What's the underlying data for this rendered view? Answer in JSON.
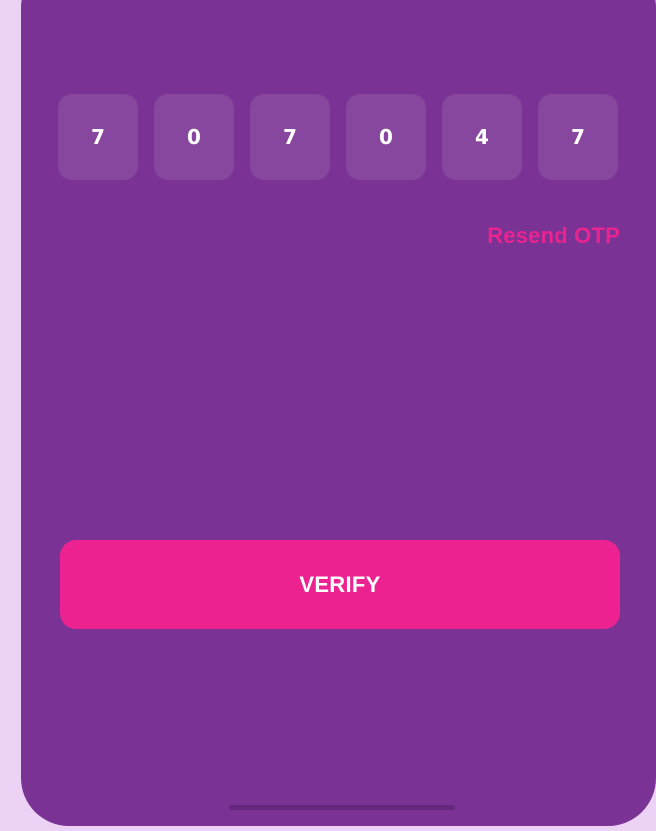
{
  "otp": {
    "digits": [
      "7",
      "0",
      "7",
      "0",
      "4",
      "7"
    ]
  },
  "resend_label": "Resend OTP",
  "verify_label": "VERIFY",
  "colors": {
    "page_bg": "#ecd3f6",
    "card_bg": "#7a3394",
    "accent": "#ec2291"
  }
}
